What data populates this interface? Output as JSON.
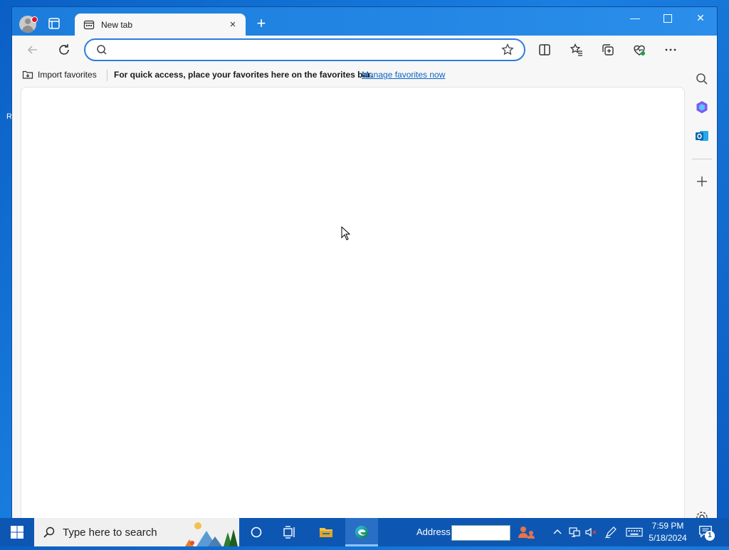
{
  "desktop": {
    "stub_text": "R"
  },
  "browser": {
    "tab": {
      "title": "New tab",
      "close": "×"
    },
    "new_tab": "+",
    "window_controls": {
      "minimize": "—",
      "close": "✕"
    },
    "address_bar": {
      "value": "",
      "placeholder": ""
    },
    "favorites_bar": {
      "import_label": "Import favorites",
      "message": "For quick access, place your favorites here on the favorites bar.",
      "manage_link": "Manage favorites now"
    },
    "toolbar_icons": [
      "back-icon",
      "refresh-icon",
      "favorite-star-icon",
      "split-screen-icon",
      "favorites-icon",
      "collections-icon",
      "browser-essentials-icon",
      "more-icon",
      "copilot-icon"
    ],
    "sidebar_icons": [
      "search-icon",
      "copilot-app-icon",
      "outlook-icon",
      "add-icon",
      "settings-icon"
    ],
    "colors": {
      "titlebar": "#1b7cdc",
      "accent": "#2a7de1",
      "link": "#0b62c4"
    }
  },
  "taskbar": {
    "search_placeholder": "Type here to search",
    "address_label": "Address",
    "clock": {
      "time": "7:59 PM",
      "date": "5/18/2024"
    },
    "notification_count": "1"
  }
}
